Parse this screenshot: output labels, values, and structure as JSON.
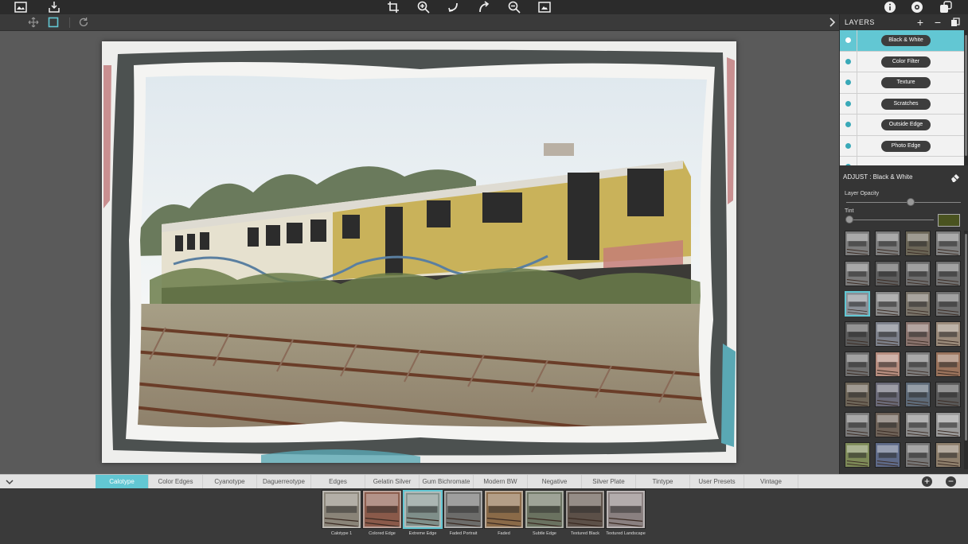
{
  "toolbar": {
    "left_icons": [
      "image-browser-icon",
      "import-icon"
    ],
    "center_icons": [
      "crop-icon",
      "zoom-in-icon",
      "undo-icon",
      "redo-icon",
      "zoom-out-icon",
      "fit-screen-icon"
    ],
    "right_icons": [
      "info-icon",
      "settings-icon",
      "share-icon"
    ]
  },
  "toolrow": {
    "icons": [
      "move-icon",
      "selection-icon",
      "rotate-icon"
    ]
  },
  "layers": {
    "title": "LAYERS",
    "items": [
      {
        "label": "Black & White",
        "active": true
      },
      {
        "label": "Color Filter",
        "active": false
      },
      {
        "label": "Texture",
        "active": false
      },
      {
        "label": "Scratches",
        "active": false
      },
      {
        "label": "Outside Edge",
        "active": false
      },
      {
        "label": "Photo Edge",
        "active": false
      },
      {
        "label": "",
        "active": false
      }
    ]
  },
  "adjust": {
    "title": "ADJUST : Black & White",
    "opacity_label": "Layer Opacity",
    "opacity_value": 0.56,
    "tint_label": "Tint",
    "tint_value": 0.0,
    "tint_color": "#4a5320",
    "selected_preset_index": 8,
    "preset_colors": [
      "#7c7c7c",
      "#7d7d7d",
      "#6b6657",
      "#7f7f7f",
      "#7a7a7a",
      "#5e5e5e",
      "#6d6d6d",
      "#707070",
      "#8a8f96",
      "#888888",
      "#7a746a",
      "#6f6f6f",
      "#5a5a5a",
      "#7c808a",
      "#8a746e",
      "#9a8a7a",
      "#6f6f6f",
      "#b58c7e",
      "#7c7c7c",
      "#9a735c",
      "#6d6558",
      "#6a6a78",
      "#5d6a78",
      "#5a5a5a",
      "#7a7a7a",
      "#6e6258",
      "#8a8a8a",
      "#9a9a9a",
      "#7d8a58",
      "#5e6a88",
      "#777777",
      "#8e7f6c"
    ]
  },
  "tabs": {
    "items": [
      "Calotype",
      "Color Edges",
      "Cyanotype",
      "Daguerreotype",
      "Edges",
      "Gelatin Silver",
      "Gum Bichromate",
      "Modern BW",
      "Negative",
      "Silver Plate",
      "Tintype",
      "User Presets",
      "Vintage"
    ],
    "active_index": 0,
    "add_label": "+",
    "remove_label": "−"
  },
  "presets": {
    "selected_index": 2,
    "items": [
      {
        "label": "Calotype 1",
        "tone": "#8a8478"
      },
      {
        "label": "Colored Edge",
        "tone": "#8a5a4a"
      },
      {
        "label": "Extreme Edge",
        "tone": "#7f8f8a"
      },
      {
        "label": "Faded Portrait",
        "tone": "#6c6c6a"
      },
      {
        "label": "Faded",
        "tone": "#8a6a48"
      },
      {
        "label": "Subtle Edge",
        "tone": "#6a7260"
      },
      {
        "label": "Textured Black",
        "tone": "#5c5048"
      },
      {
        "label": "Textured Landscape",
        "tone": "#8a8080"
      }
    ]
  },
  "colors": {
    "accent": "#62c7d3",
    "panel_bg": "#353535",
    "canvas_bg": "#5a5a5a"
  }
}
